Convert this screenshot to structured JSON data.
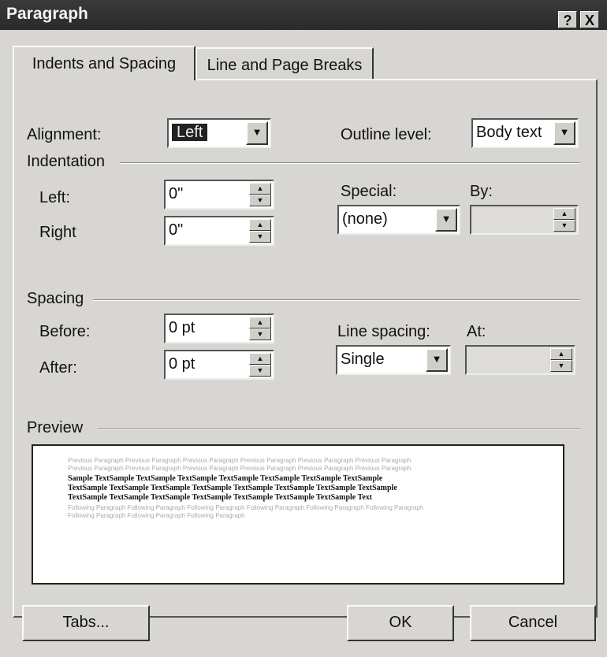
{
  "window": {
    "title": "Paragraph",
    "help_glyph": "?",
    "close_glyph": "X"
  },
  "tabs": [
    {
      "label": "Indents and Spacing",
      "active": true
    },
    {
      "label": "Line and Page Breaks",
      "active": false
    }
  ],
  "general": {
    "alignment_label": "Alignment:",
    "alignment_value": "Left",
    "outline_label": "Outline level:",
    "outline_value": "Body text"
  },
  "indentation": {
    "group_label": "Indentation",
    "left_label": "Left:",
    "left_value": "0\"",
    "right_label": "Right",
    "right_value": "0\"",
    "special_label": "Special:",
    "special_value": "(none)",
    "by_label": "By:",
    "by_value": ""
  },
  "spacing": {
    "group_label": "Spacing",
    "before_label": "Before:",
    "before_value": "0 pt",
    "after_label": "After:",
    "after_value": "0 pt",
    "line_spacing_label": "Line spacing:",
    "line_spacing_value": "Single",
    "at_label": "At:",
    "at_value": ""
  },
  "preview": {
    "group_label": "Preview",
    "prev_lines": [
      "Previous Paragraph Previous Paragraph Previous Paragraph Previous Paragraph Previous Paragraph Previous Paragraph",
      "Previous Paragraph Previous Paragraph Previous Paragraph Previous Paragraph Previous Paragraph Previous Paragraph"
    ],
    "sample_lines": [
      "Sample TextSample TextSample TextSample TextSample TextSample TextSample TextSample",
      "TextSample TextSample TextSample TextSample TextSample TextSample TextSample TextSample",
      "TextSample TextSample TextSample TextSample TextSample TextSample TextSample Text"
    ],
    "next_lines": [
      "Following Paragraph Following Paragraph Following Paragraph Following Paragraph Following Paragraph Following Paragraph",
      "Following Paragraph Following Paragraph Following Paragraph"
    ]
  },
  "buttons": {
    "tabs": "Tabs...",
    "ok": "OK",
    "cancel": "Cancel"
  },
  "icons": {
    "dropdown": "chevron-down-icon",
    "spin": "spinner-icon"
  },
  "colors": {
    "title_bar": "#2a2a2a",
    "dialog_bg": "#d8d6d2",
    "selection": "#222222"
  }
}
